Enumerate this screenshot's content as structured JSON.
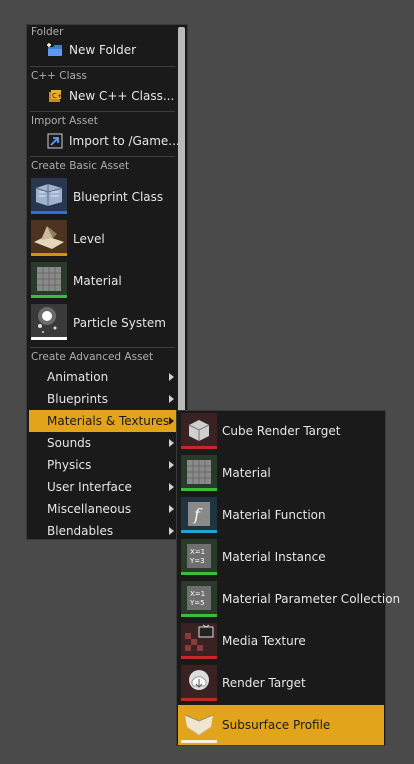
{
  "menu": {
    "sections": {
      "folder": "Folder",
      "cpp": "C++ Class",
      "import": "Import Asset",
      "basic": "Create Basic Asset",
      "advanced": "Create Advanced Asset"
    },
    "new_folder": "New Folder",
    "new_cpp": "New C++ Class...",
    "import_to": "Import to /Game...",
    "basic_items": [
      {
        "label": "Blueprint Class",
        "icon": "blueprint-class-icon"
      },
      {
        "label": "Level",
        "icon": "level-icon"
      },
      {
        "label": "Material",
        "icon": "material-icon"
      },
      {
        "label": "Particle System",
        "icon": "particle-system-icon"
      }
    ],
    "advanced_items": [
      {
        "label": "Animation"
      },
      {
        "label": "Blueprints"
      },
      {
        "label": "Materials & Textures"
      },
      {
        "label": "Sounds"
      },
      {
        "label": "Physics"
      },
      {
        "label": "User Interface"
      },
      {
        "label": "Miscellaneous"
      },
      {
        "label": "Blendables"
      }
    ]
  },
  "submenu": {
    "items": [
      {
        "label": "Cube Render Target",
        "icon": "cube-render-target-icon"
      },
      {
        "label": "Material",
        "icon": "material-icon"
      },
      {
        "label": "Material Function",
        "icon": "material-function-icon"
      },
      {
        "label": "Material Instance",
        "icon": "material-instance-icon"
      },
      {
        "label": "Material Parameter Collection",
        "icon": "material-parameter-collection-icon"
      },
      {
        "label": "Media Texture",
        "icon": "media-texture-icon"
      },
      {
        "label": "Render Target",
        "icon": "render-target-icon"
      },
      {
        "label": "Subsurface Profile",
        "icon": "subsurface-profile-icon"
      }
    ]
  },
  "colors": {
    "highlight": "#e1a41a",
    "menu_bg": "#1a1a1a",
    "page_bg": "#4a4a4a"
  }
}
